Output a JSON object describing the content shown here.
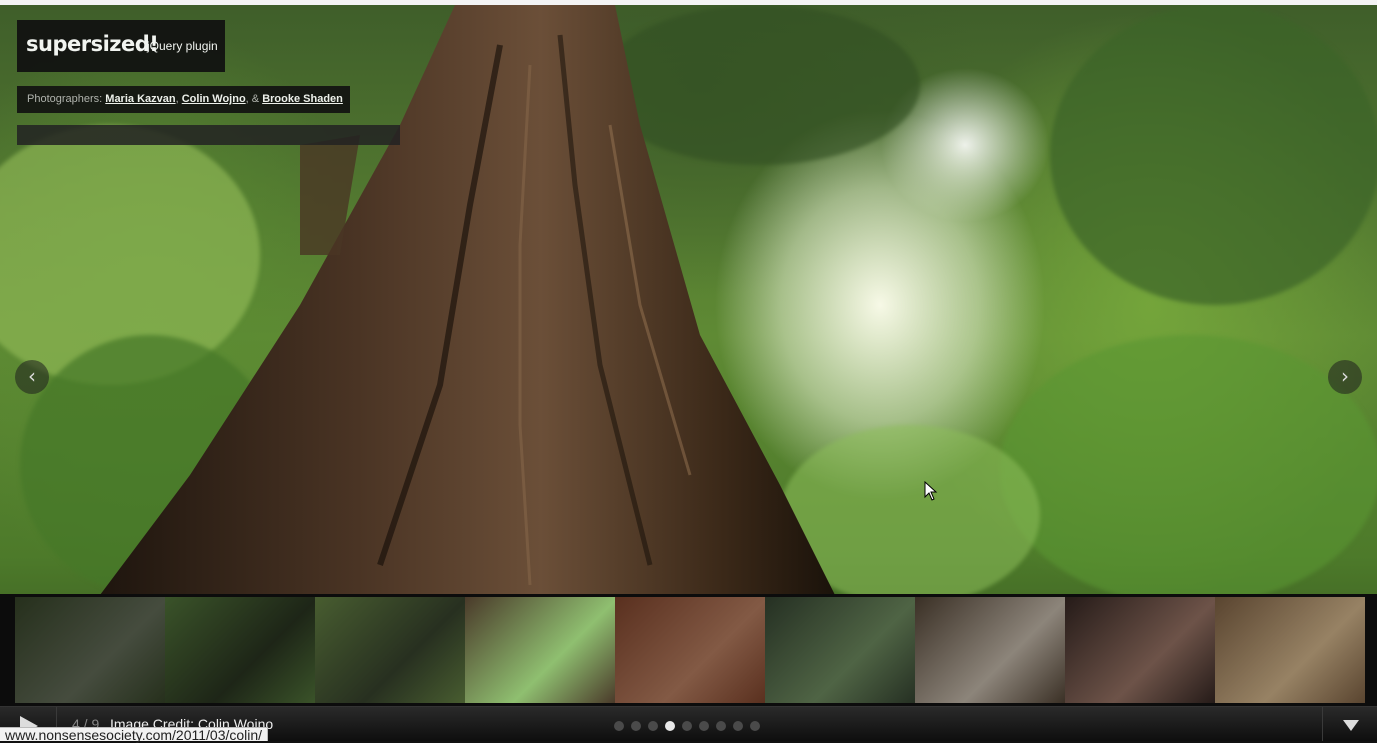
{
  "logo": {
    "main": "supersized!",
    "sub": "jQuery plugin"
  },
  "credits": {
    "prefix": "Photographers:",
    "photographers": [
      "Maria Kazvan",
      "Colin Wojno",
      "Brooke Shaden"
    ],
    "sep1": ",",
    "sep2": ", &"
  },
  "nav": {
    "prev": "‹",
    "next": "›"
  },
  "thumbnails": [
    {
      "label": "thumb-1",
      "colors": [
        "#3b4a2c",
        "#6b7560"
      ]
    },
    {
      "label": "thumb-2",
      "colors": [
        "#5a8040",
        "#2e3a24"
      ]
    },
    {
      "label": "thumb-3",
      "colors": [
        "#6f8f4a",
        "#3d4a32"
      ]
    },
    {
      "label": "thumb-4",
      "colors": [
        "#4a3a2a",
        "#8fbf70"
      ]
    },
    {
      "label": "thumb-5",
      "colors": [
        "#8a4a30",
        "#c98a6a"
      ]
    },
    {
      "label": "thumb-6",
      "colors": [
        "#3a4a36",
        "#7a9a6a"
      ]
    },
    {
      "label": "thumb-7",
      "colors": [
        "#5a4a3a",
        "#d8ccbc"
      ]
    },
    {
      "label": "thumb-8",
      "colors": [
        "#3a2a26",
        "#a88070"
      ]
    },
    {
      "label": "thumb-9",
      "colors": [
        "#8a6a4a",
        "#e8c89a"
      ]
    }
  ],
  "controls": {
    "counter": "4 / 9",
    "caption": "Image Credit: Colin Wojno",
    "slide_count": 9,
    "active_slide": 4
  },
  "statusbar": {
    "url": "www.nonsensesociety.com/2011/03/colin/"
  }
}
